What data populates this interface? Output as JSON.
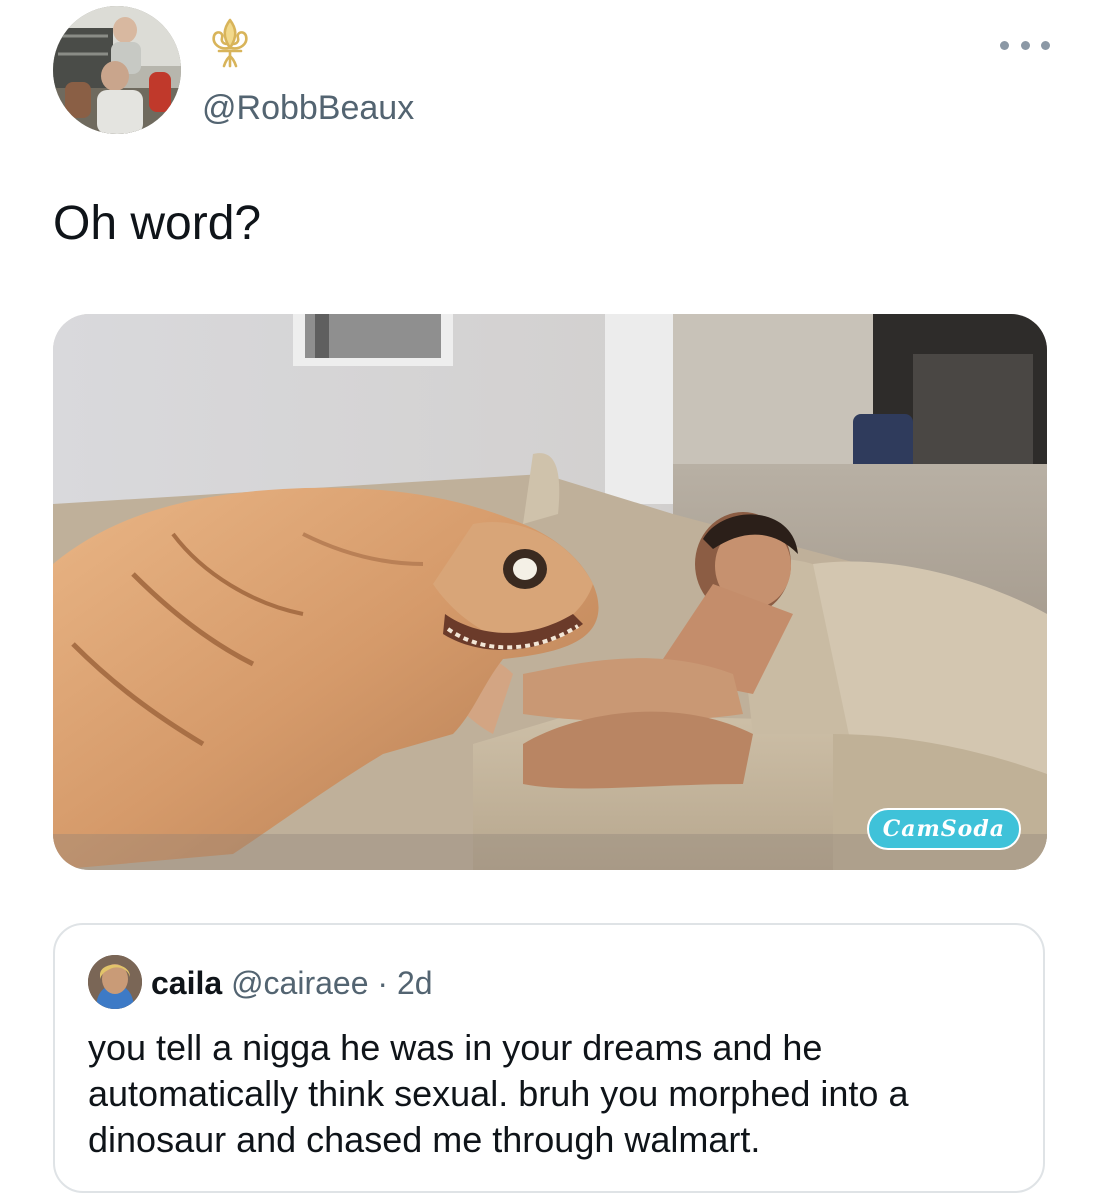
{
  "tweet": {
    "author": {
      "handle": "@RobbBeaux",
      "badge_icon": "fleur-de-lis-icon",
      "badge_color": "#d8b45a"
    },
    "more_icon": "more-options-icon",
    "text": "Oh word?",
    "media": {
      "watermark": "CamSoda"
    }
  },
  "quote": {
    "name": "caila",
    "handle": "@cairaee",
    "separator": "·",
    "time": "2d",
    "text_lines": [
      "you tell a nigga he was in your dreams and he",
      "automatically think sexual. bruh you morphed into a",
      "dinosaur and chased me through walmart."
    ]
  },
  "colors": {
    "text_primary": "#0f1419",
    "text_secondary": "#536471",
    "border": "#dfe3e6"
  }
}
